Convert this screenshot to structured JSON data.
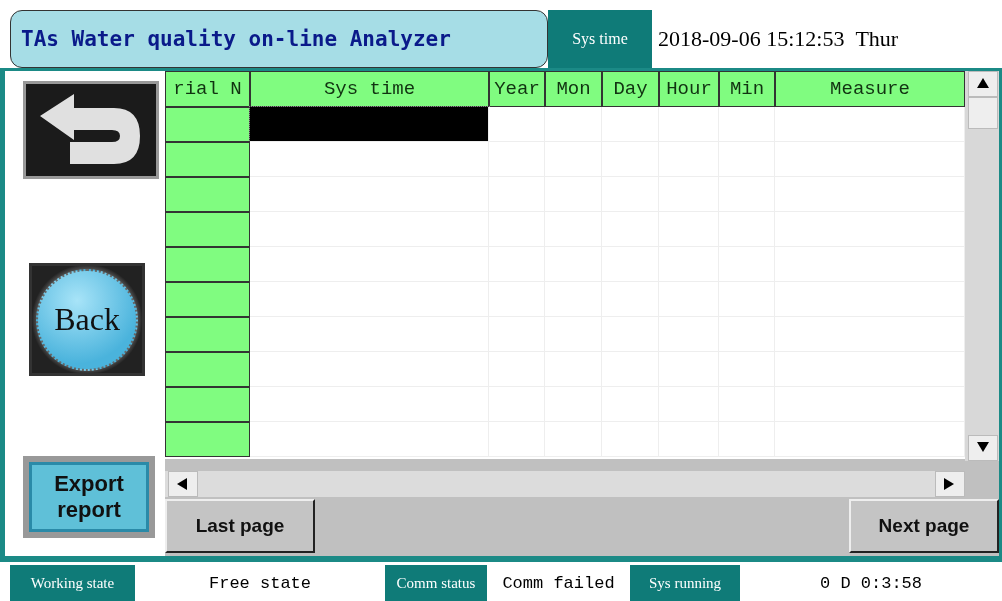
{
  "header": {
    "title": "TAs Water quality on-line Analyzer",
    "time_label": "Sys time",
    "datetime": "2018-09-06 15:12:53",
    "weekday": "Thur"
  },
  "side_buttons": {
    "back": "Back",
    "export": "Export report"
  },
  "table": {
    "columns": [
      "rial N",
      "Sys time",
      "Year",
      "Mon",
      "Day",
      "Hour",
      "Min",
      "Measure"
    ],
    "rows": [
      {
        "selected": true
      },
      {
        "selected": false
      },
      {
        "selected": false
      },
      {
        "selected": false
      },
      {
        "selected": false
      },
      {
        "selected": false
      },
      {
        "selected": false
      },
      {
        "selected": false
      },
      {
        "selected": false
      },
      {
        "selected": false
      }
    ]
  },
  "pager": {
    "last": "Last page",
    "next": "Next page"
  },
  "status_bar": [
    {
      "label": "Working state",
      "value": "Free state"
    },
    {
      "label": "Comm status",
      "value": "Comm failed"
    },
    {
      "label": "Sys running",
      "value": "0 D 0:3:58"
    }
  ]
}
